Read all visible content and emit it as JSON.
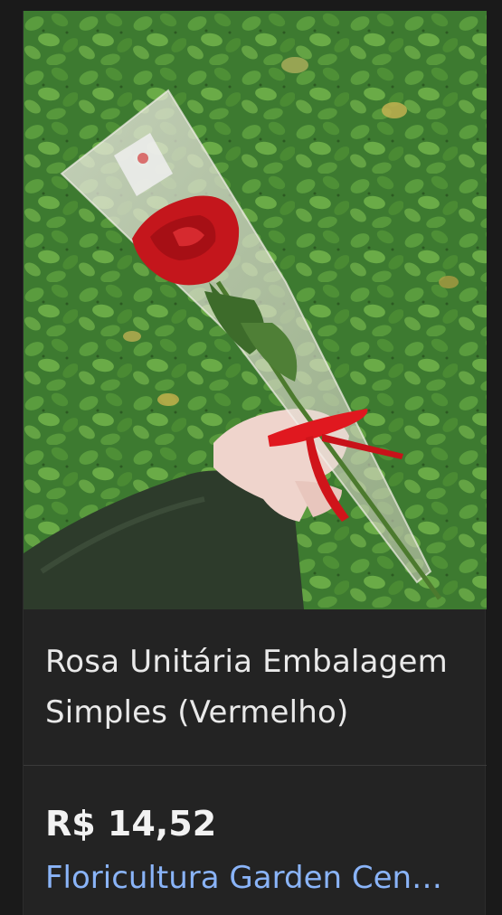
{
  "product": {
    "image_alt": "Rosa vermelha em embalagem simples",
    "title": "Rosa Unitária Embalagem Simples (Vermelho)",
    "price": "R$ 14,52",
    "seller": "Floricultura Garden Cen…"
  },
  "colors": {
    "background": "#1a1a1a",
    "card": "#232323",
    "title_text": "#e9e9e9",
    "price_text": "#f2f2f2",
    "seller_link": "#8ab4f8",
    "rose": "#c4161c",
    "ribbon": "#e0181f",
    "foliage": "#3f7d32"
  }
}
